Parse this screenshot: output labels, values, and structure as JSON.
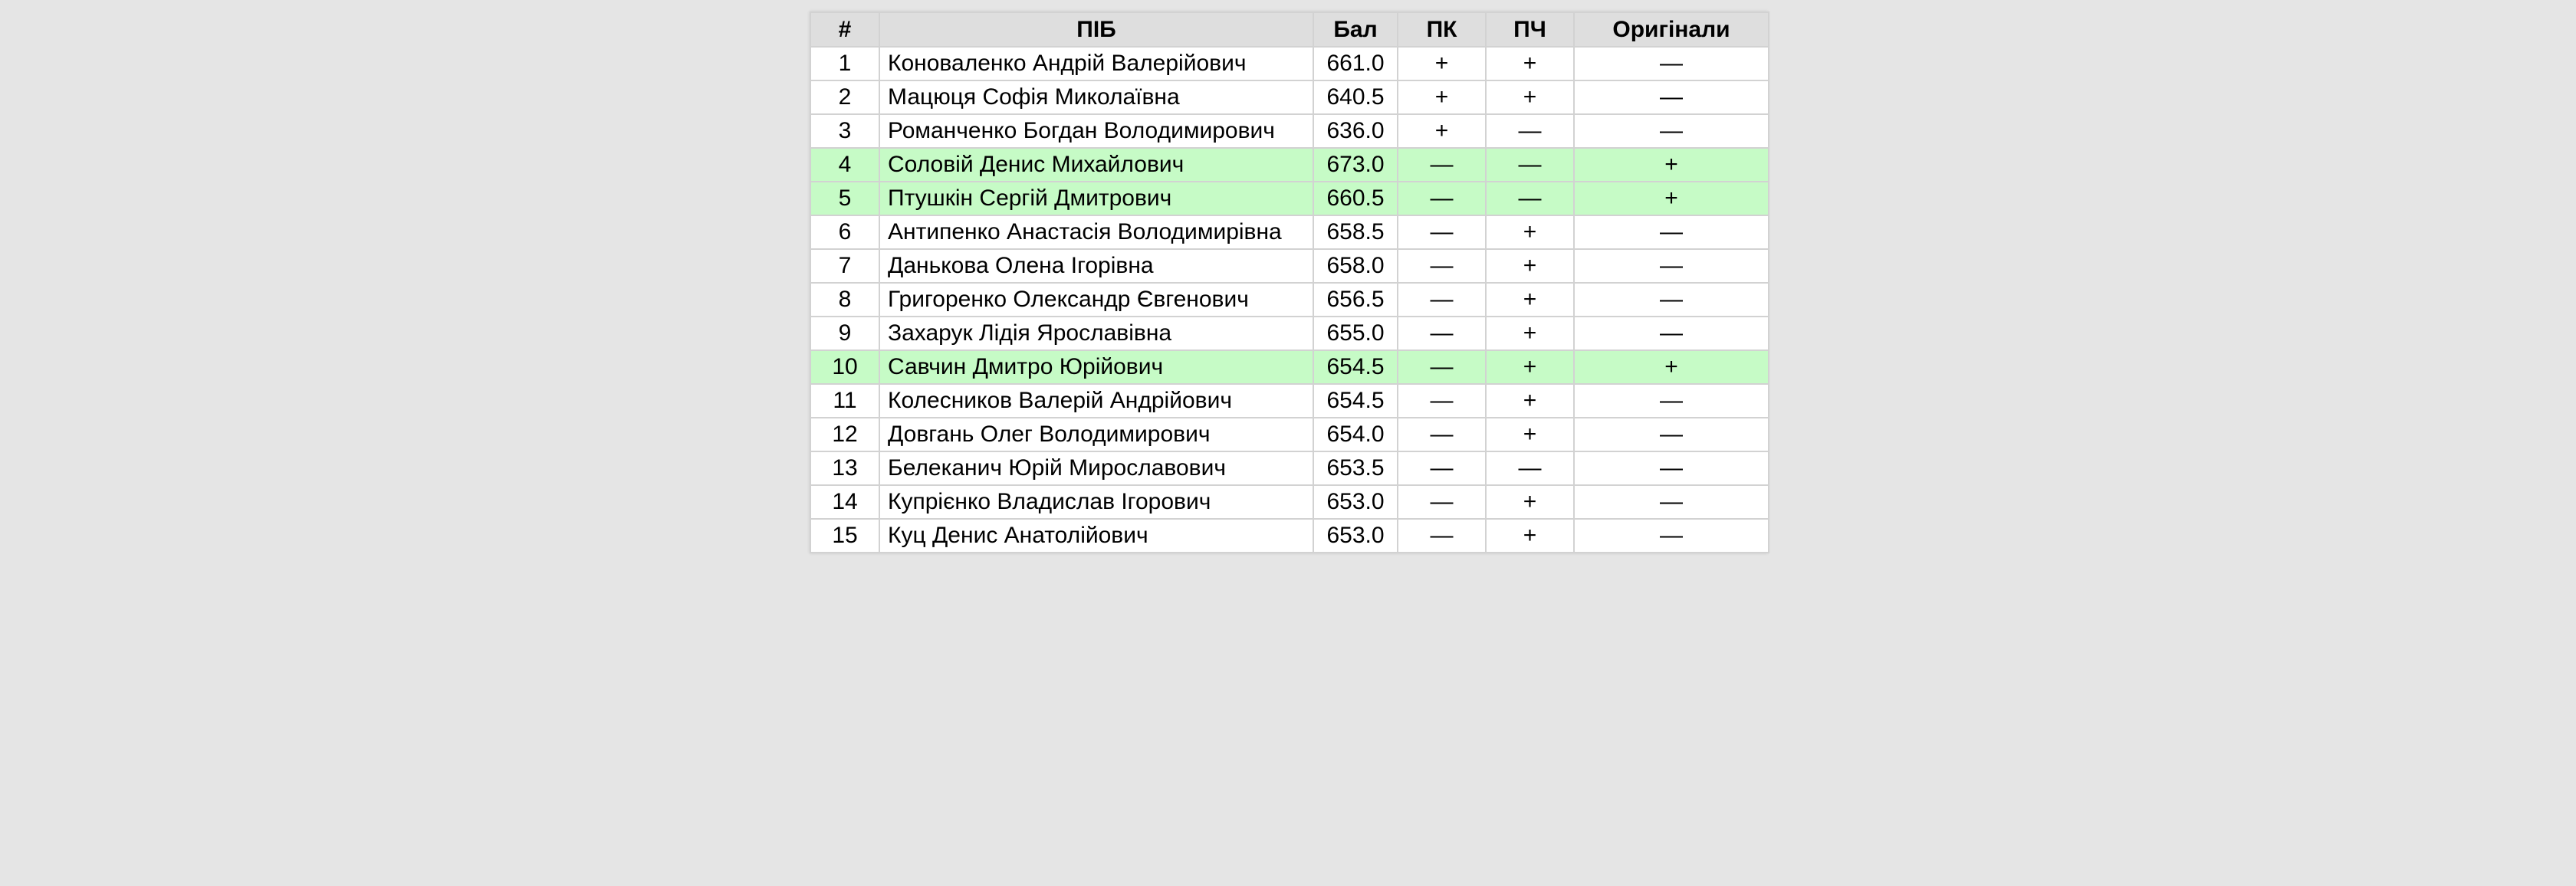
{
  "table": {
    "headers": [
      "#",
      "ПІБ",
      "Бал",
      "ПК",
      "ПЧ",
      "Оригінали"
    ],
    "rows": [
      {
        "num": "1",
        "name": "Коноваленко Андрій Валерійович",
        "score": "661.0",
        "pk": "+",
        "pch": "+",
        "orig": "—",
        "highlight": false
      },
      {
        "num": "2",
        "name": "Мацюця Софія Миколаївна",
        "score": "640.5",
        "pk": "+",
        "pch": "+",
        "orig": "—",
        "highlight": false
      },
      {
        "num": "3",
        "name": "Романченко Богдан Володимирович",
        "score": "636.0",
        "pk": "+",
        "pch": "—",
        "orig": "—",
        "highlight": false
      },
      {
        "num": "4",
        "name": "Соловій Денис Михайлович",
        "score": "673.0",
        "pk": "—",
        "pch": "—",
        "orig": "+",
        "highlight": true
      },
      {
        "num": "5",
        "name": "Птушкін Сергій Дмитрович",
        "score": "660.5",
        "pk": "—",
        "pch": "—",
        "orig": "+",
        "highlight": true
      },
      {
        "num": "6",
        "name": "Антипенко Анастасія Володимирівна",
        "score": "658.5",
        "pk": "—",
        "pch": "+",
        "orig": "—",
        "highlight": false
      },
      {
        "num": "7",
        "name": "Данькова Олена Ігорівна",
        "score": "658.0",
        "pk": "—",
        "pch": "+",
        "orig": "—",
        "highlight": false
      },
      {
        "num": "8",
        "name": "Григоренко Олександр Євгенович",
        "score": "656.5",
        "pk": "—",
        "pch": "+",
        "orig": "—",
        "highlight": false
      },
      {
        "num": "9",
        "name": "Захарук Лідія Ярославівна",
        "score": "655.0",
        "pk": "—",
        "pch": "+",
        "orig": "—",
        "highlight": false
      },
      {
        "num": "10",
        "name": "Савчин Дмитро Юрійович",
        "score": "654.5",
        "pk": "—",
        "pch": "+",
        "orig": "+",
        "highlight": true
      },
      {
        "num": "11",
        "name": "Колесников Валерій Андрійович",
        "score": "654.5",
        "pk": "—",
        "pch": "+",
        "orig": "—",
        "highlight": false
      },
      {
        "num": "12",
        "name": "Довгань Олег Володимирович",
        "score": "654.0",
        "pk": "—",
        "pch": "+",
        "orig": "—",
        "highlight": false
      },
      {
        "num": "13",
        "name": "Белеканич Юрій Мирославович",
        "score": "653.5",
        "pk": "—",
        "pch": "—",
        "orig": "—",
        "highlight": false
      },
      {
        "num": "14",
        "name": "Купрієнко Владислав Ігорович",
        "score": "653.0",
        "pk": "—",
        "pch": "+",
        "orig": "—",
        "highlight": false
      },
      {
        "num": "15",
        "name": "Куц Денис Анатолійович",
        "score": "653.0",
        "pk": "—",
        "pch": "+",
        "orig": "—",
        "highlight": false
      }
    ]
  },
  "colors": {
    "page_background": "#e5e5e5",
    "header_background": "#dedede",
    "highlight_row": "#c6fbc6",
    "row_background": "#ffffff",
    "border": "#d2d2d2"
  }
}
